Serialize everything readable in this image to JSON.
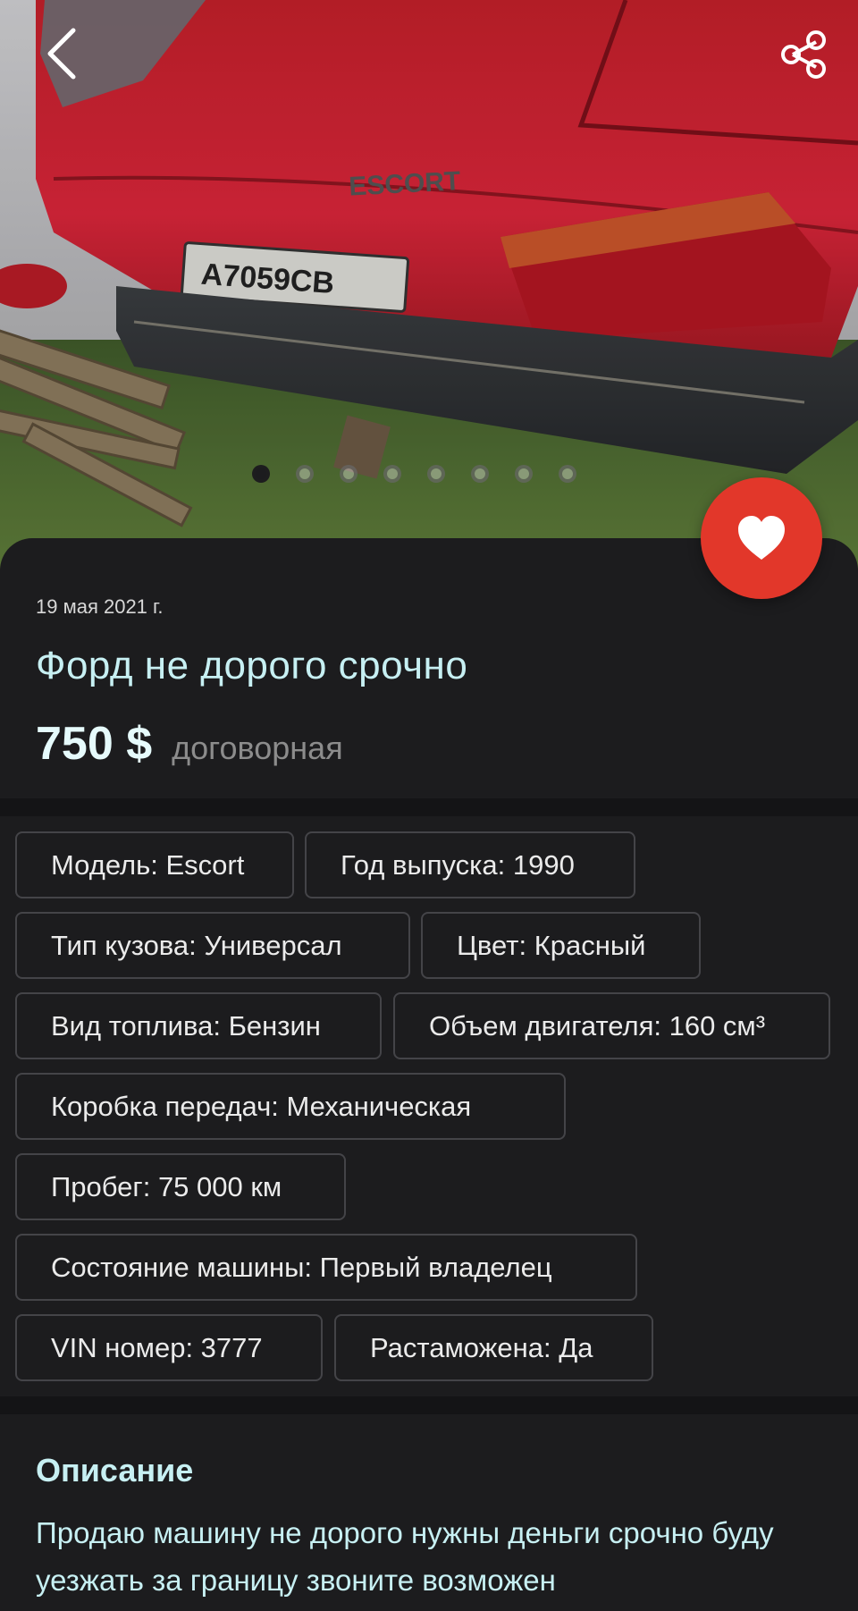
{
  "gallery": {
    "plate_text": "A7059CB",
    "badge_text": "ESCORT",
    "photo_count": 8,
    "active_index": 0
  },
  "listing": {
    "date": "19 мая 2021 г.",
    "title": "Форд не дорого срочно",
    "price": "750 $",
    "price_note": "договорная"
  },
  "specs": [
    "Модель: Escort",
    "Год выпуска: 1990",
    "Тип кузова: Универсал",
    "Цвет: Красный",
    "Вид топлива: Бензин",
    "Объем двигателя: 160 см³",
    "Коробка передач: Механическая",
    "Пробег: 75 000 км",
    "Состояние машины: Первый владелец",
    "VIN номер: 3777",
    "Растаможена: Да"
  ],
  "description": {
    "heading": "Описание",
    "text": "Продаю машину не дорого нужны деньги срочно буду уезжать за границу звоните возможен"
  },
  "colors": {
    "accent_red": "#e2372a",
    "background": "#1c1c1e",
    "title_color": "#c7f0f3",
    "chip_border": "#444448"
  },
  "icons": {
    "back": "chevron-left-icon",
    "share": "share-icon",
    "favorite": "heart-icon"
  }
}
